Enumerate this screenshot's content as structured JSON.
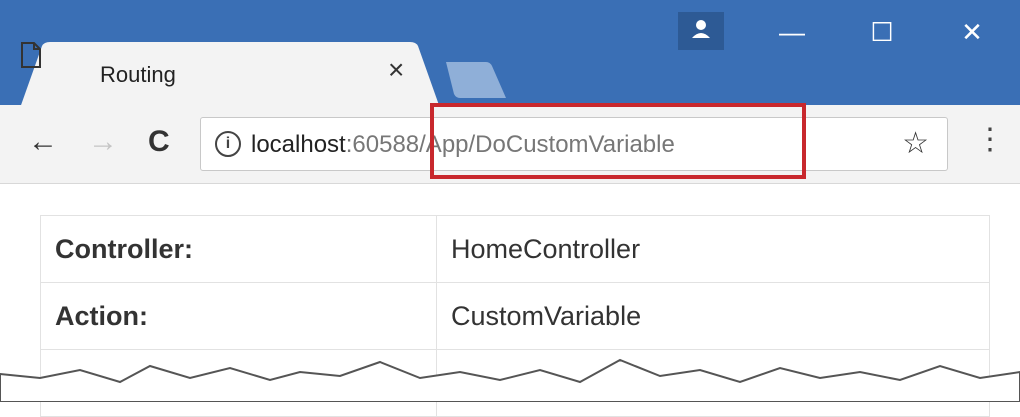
{
  "browser": {
    "tab": {
      "title": "Routing",
      "close_label": "×"
    },
    "window_controls": {
      "minimize": "—",
      "maximize": "☐",
      "close": "✕"
    },
    "nav": {
      "back": "←",
      "forward": "→",
      "reload": "C"
    },
    "address": {
      "info_icon": "i",
      "host": "localhost",
      "rest": ":60588/App/DoCustomVariable"
    },
    "star": "☆",
    "menu": "⋮"
  },
  "table": {
    "rows": [
      {
        "key": "Controller:",
        "value": "HomeController"
      },
      {
        "key": "Action:",
        "value": "CustomVariable"
      }
    ]
  },
  "colors": {
    "titlebar": "#3a6fb5",
    "highlight": "#c8282d"
  }
}
